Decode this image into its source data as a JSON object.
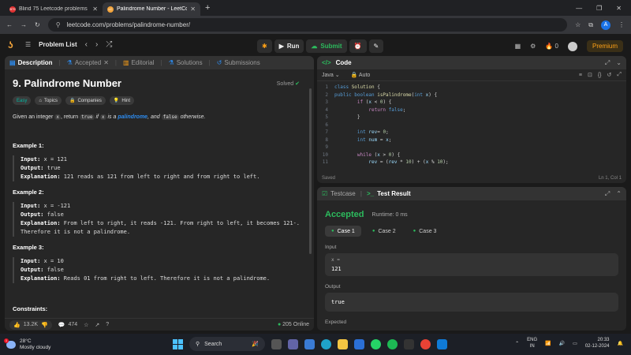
{
  "browser": {
    "tabs": [
      {
        "favicon": "B75",
        "title": "Blind 75 Leetcode problems : D",
        "active": false
      },
      {
        "favicon": "LC",
        "title": "Palindrome Number - LeetCode",
        "active": true
      }
    ],
    "url": "leetcode.com/problems/palindrome-number/",
    "profile_initial": "A"
  },
  "lc_nav": {
    "problem_list": "Problem List",
    "run": "Run",
    "submit": "Submit",
    "streak": "0",
    "premium": "Premium"
  },
  "left": {
    "tabs": [
      "Description",
      "Accepted",
      "Editorial",
      "Solutions",
      "Submissions"
    ],
    "title": "9. Palindrome Number",
    "solved": "Solved",
    "chips": [
      "Easy",
      "Topics",
      "Companies",
      "Hint"
    ],
    "desc": {
      "p1": "Given an integer ",
      "x": "x",
      "p2": ", return ",
      "true": "true",
      "p3": " if ",
      "x2": "x",
      "p4": " is a ",
      "link": "palindrome",
      "p5": ", and ",
      "false": "false",
      "p6": " otherwise."
    },
    "examples": [
      {
        "h": "Example 1:",
        "input": "x = 121",
        "output": "true",
        "explanation": "121 reads as 121 from left to right and from right to left."
      },
      {
        "h": "Example 2:",
        "input": "x = -121",
        "output": "false",
        "explanation": "From left to right, it reads -121. From right to left, it becomes 121-. Therefore it is not a palindrome."
      },
      {
        "h": "Example 3:",
        "input": "x = 10",
        "output": "false",
        "explanation": "Reads 01 from right to left. Therefore it is not a palindrome."
      }
    ],
    "labels": {
      "input": "Input:",
      "output": "Output:",
      "explanation": "Explanation:"
    },
    "constraints": "Constraints:",
    "footer": {
      "likes": "13.2K",
      "comments": "474",
      "online": "205 Online"
    }
  },
  "code": {
    "title": "Code",
    "language": "Java",
    "autosave": "Auto",
    "lines": [
      "class Solution {",
      "    public boolean isPalindrome(int x) {",
      "        if (x < 0) {",
      "            return false;",
      "        }",
      "",
      "        int rev= 0;",
      "        int num = x;",
      "",
      "        while (x > 0) {",
      "            rev = (rev * 10) + (x % 10);"
    ],
    "saved": "Saved",
    "cursor": "Ln 1, Col 1"
  },
  "result": {
    "tabs": [
      "Testcase",
      "Test Result"
    ],
    "status": "Accepted",
    "runtime": "Runtime: 0 ms",
    "cases": [
      "Case 1",
      "Case 2",
      "Case 3"
    ],
    "input_label": "Input",
    "input_var": "x =",
    "input_val": "121",
    "output_label": "Output",
    "output_val": "true",
    "expected_label": "Expected"
  },
  "taskbar": {
    "temp": "28°C",
    "weather": "Mostly cloudy",
    "weather_badge": "1",
    "search": "Search",
    "lang1": "ENG",
    "lang2": "IN",
    "time": "20:33",
    "date": "02-12-2024"
  },
  "colors": {
    "accent": "#2cbb5d",
    "brand": "#ffa116",
    "link": "#2d8cf0"
  }
}
